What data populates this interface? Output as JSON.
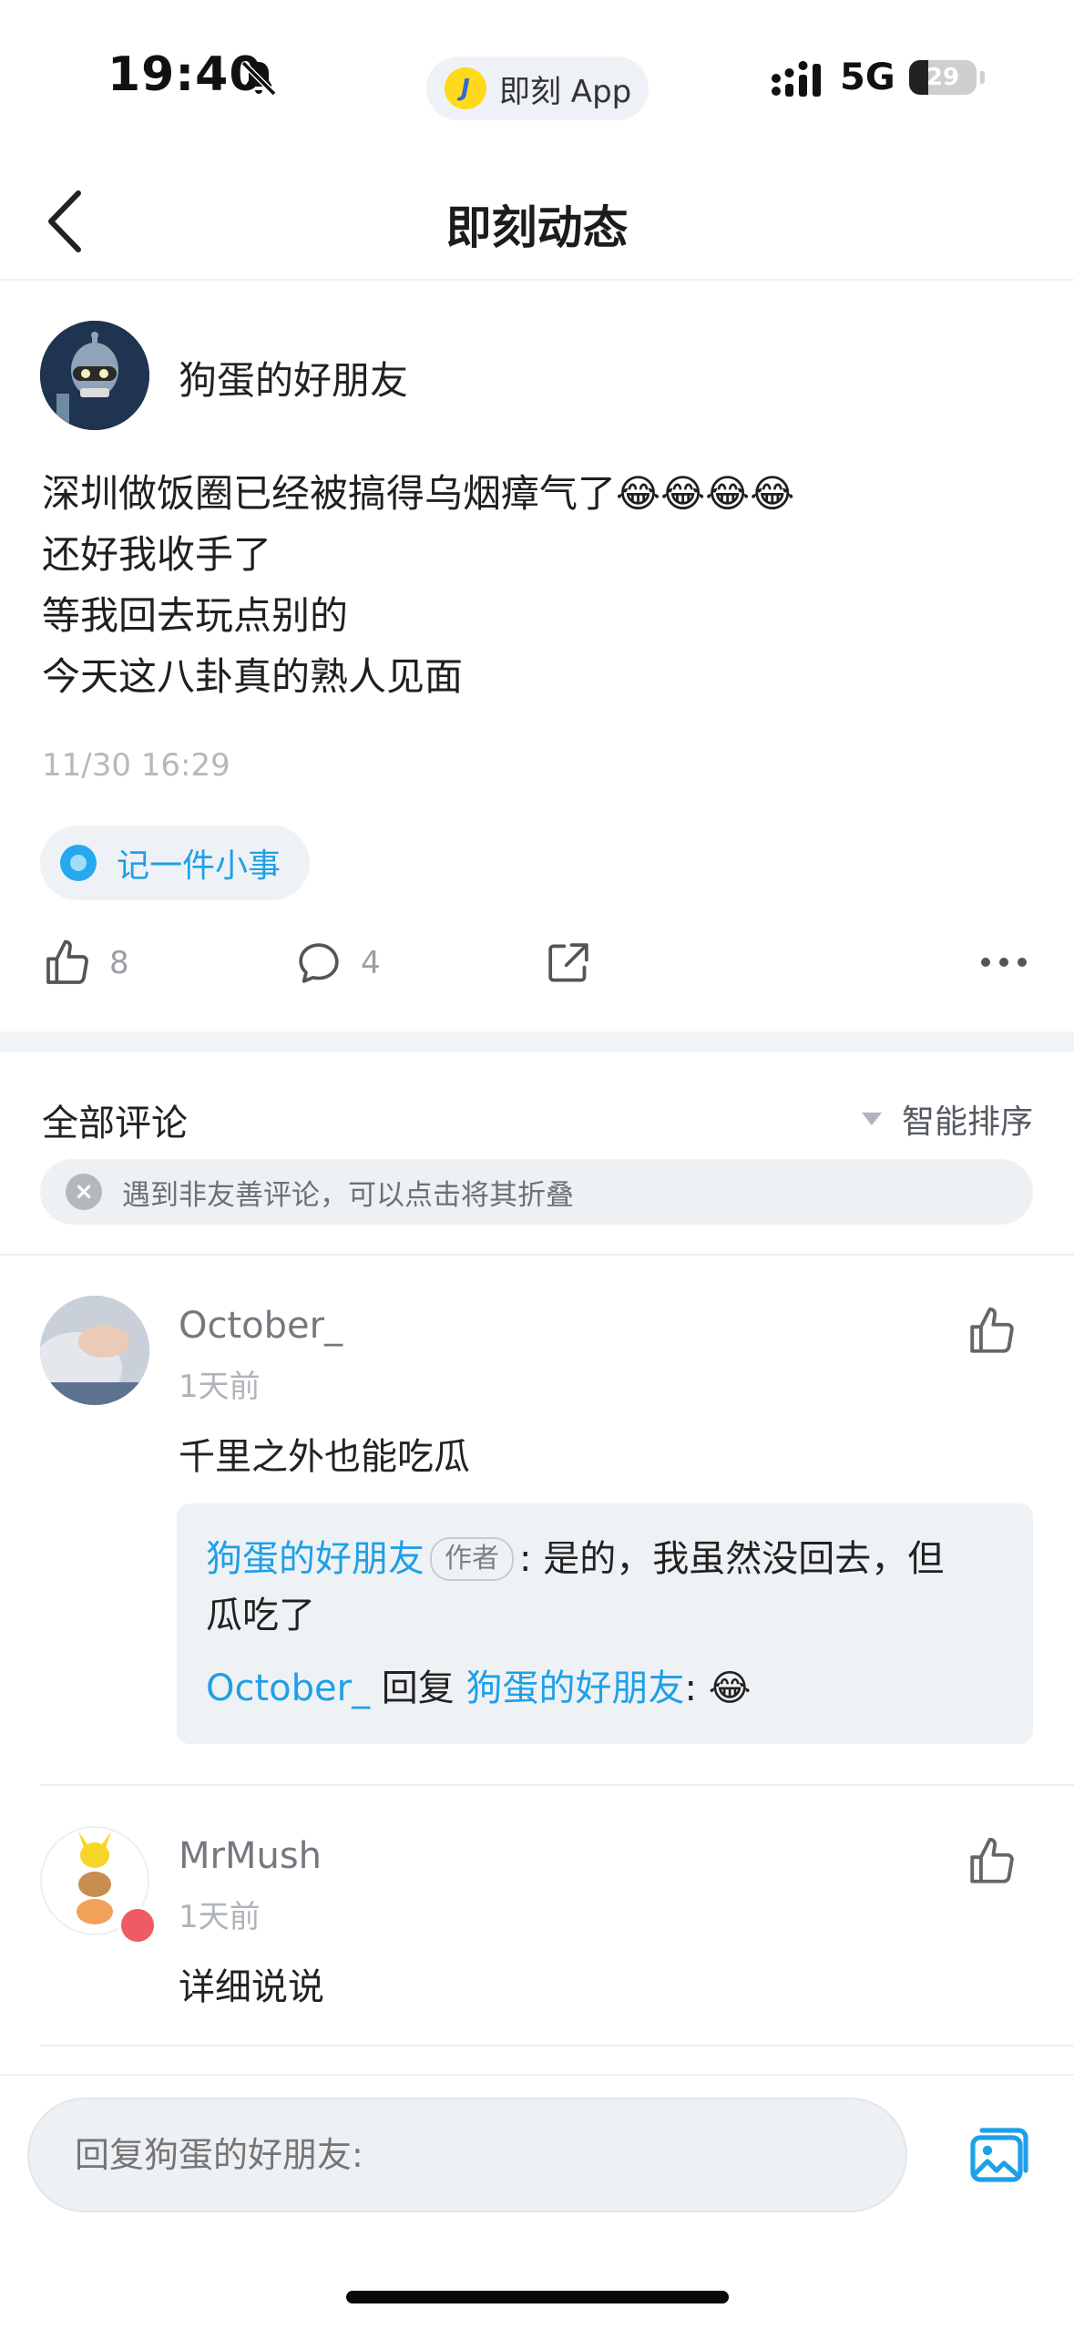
{
  "status_bar": {
    "time": "19:40",
    "app_pill": "即刻 App",
    "app_logo_glyph": "J",
    "network": "5G",
    "battery": "29",
    "battery_level": 0.29
  },
  "nav": {
    "title": "即刻动态"
  },
  "post": {
    "author": "狗蛋的好朋友",
    "lines": [
      "深圳做饭圈已经被搞得乌烟瘴气了😂😂😂😂",
      "还好我收手了",
      "等我回去玩点别的",
      "今天这八卦真的熟人见面"
    ],
    "time": "11/30 16:29",
    "topic": "记一件小事",
    "likes": "8",
    "comments": "4"
  },
  "comments_section": {
    "title": "全部评论",
    "sort_label": "智能排序",
    "notice": "遇到非友善评论，可以点击将其折叠"
  },
  "comments": [
    {
      "name": "October_",
      "time": "1天前",
      "text": "千里之外也能吃瓜",
      "replies": {
        "r1_author": "狗蛋的好朋友",
        "r1_tag": "作者",
        "r1_text_a": ": 是的，我虽然没回去，但",
        "r1_text_b": "瓜吃了",
        "r2_author": "October_",
        "r2_mid": " 回复 ",
        "r2_target": "狗蛋的好朋友",
        "r2_text": ": 😂"
      }
    },
    {
      "name": "MrMush",
      "time": "1天前",
      "text": "详细说说"
    }
  ],
  "input": {
    "placeholder": "回复狗蛋的好朋友:"
  },
  "colors": {
    "accent": "#1ea0e8",
    "topic_dot": "#25a8ee",
    "muted_text": "#9a9ea5"
  }
}
